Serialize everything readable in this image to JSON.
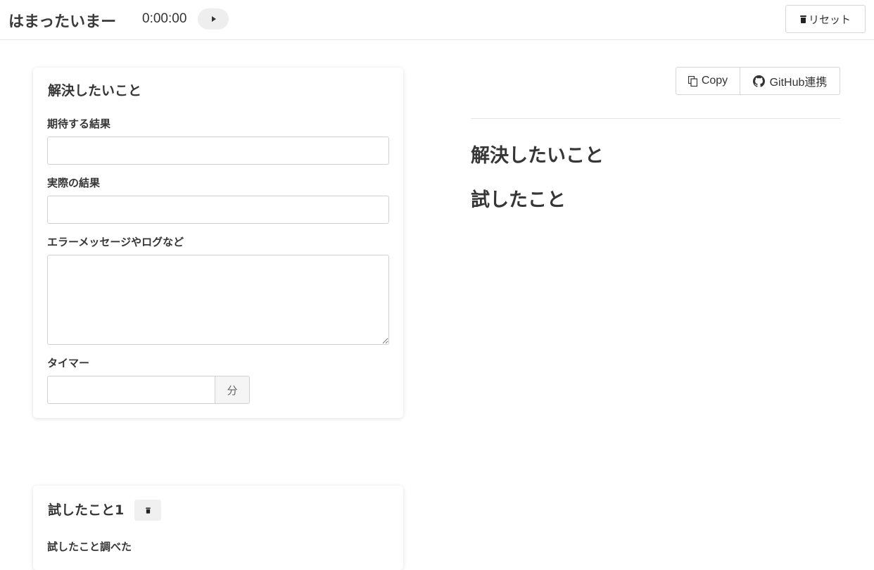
{
  "header": {
    "app_title": "はまったいまー",
    "timer": "0:00:00",
    "play_icon": "play-icon",
    "reset_label": "リセット"
  },
  "main_card": {
    "title": "解決したいこと",
    "expected_label": "期待する結果",
    "expected_value": "",
    "actual_label": "実際の結果",
    "actual_value": "",
    "error_label": "エラーメッセージやログなど",
    "error_value": "",
    "timer_label": "タイマー",
    "timer_value": "",
    "timer_unit": "分"
  },
  "tried_card": {
    "title": "試したこと1",
    "delete_icon": "trash-icon",
    "partial_label": "試したこと調べた"
  },
  "preview": {
    "copy_label": "Copy",
    "github_label": "GitHub連携",
    "headings": [
      "解決したいこと",
      "試したこと"
    ]
  }
}
